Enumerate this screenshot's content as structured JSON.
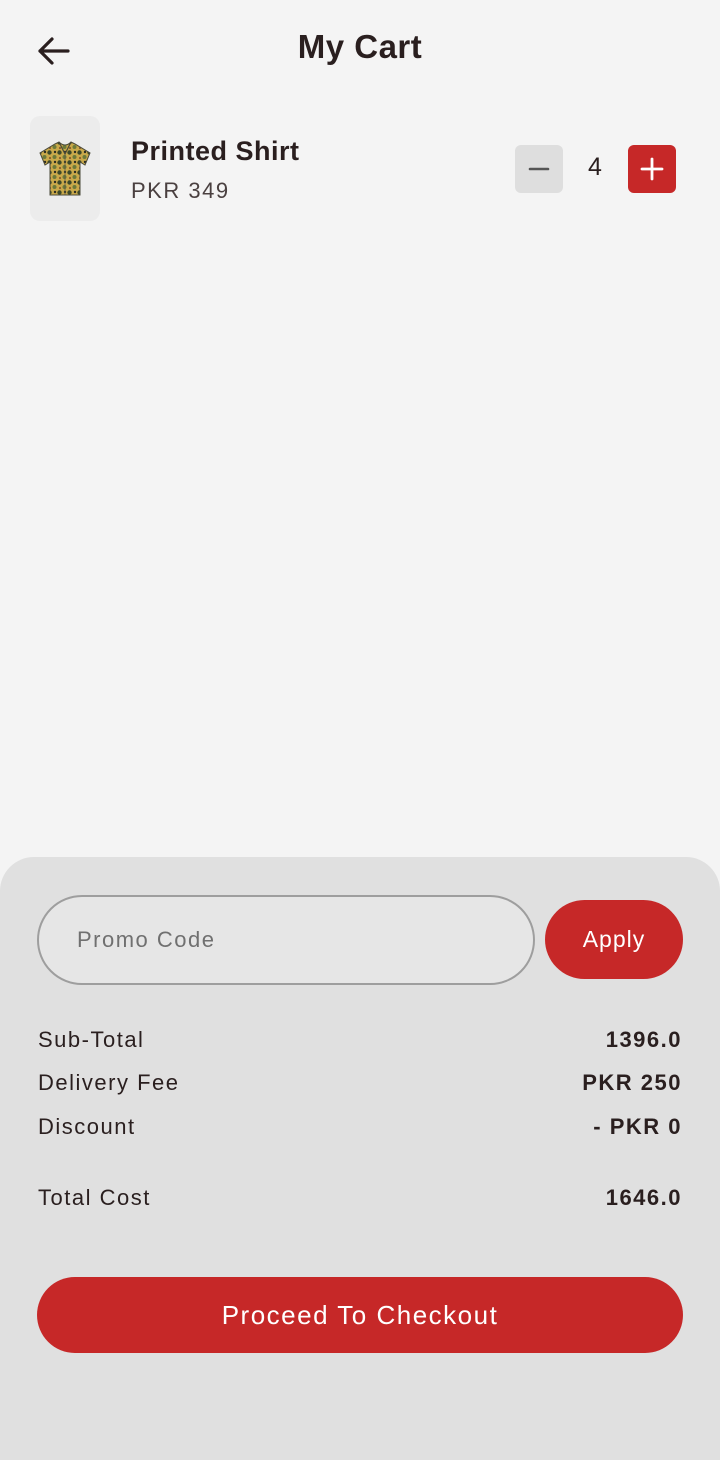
{
  "header": {
    "title": "My Cart",
    "back_icon": "arrow-left-icon"
  },
  "cart": {
    "items": [
      {
        "name": "Printed Shirt",
        "price": "PKR 349",
        "quantity": "4",
        "image_icon": "shirt-icon"
      }
    ]
  },
  "promo": {
    "placeholder": "Promo Code",
    "value": "",
    "apply_label": "Apply"
  },
  "summary": {
    "subtotal_label": "Sub-Total",
    "subtotal_value": "1396.0",
    "delivery_label": "Delivery Fee",
    "delivery_value": "PKR 250",
    "discount_label": "Discount",
    "discount_value": "- PKR 0",
    "total_label": "Total Cost",
    "total_value": "1646.0"
  },
  "checkout": {
    "label": "Proceed To Checkout"
  },
  "colors": {
    "accent": "#c62828",
    "background": "#f4f4f4",
    "panel": "#e0e0e0",
    "text": "#2a1f1f"
  }
}
